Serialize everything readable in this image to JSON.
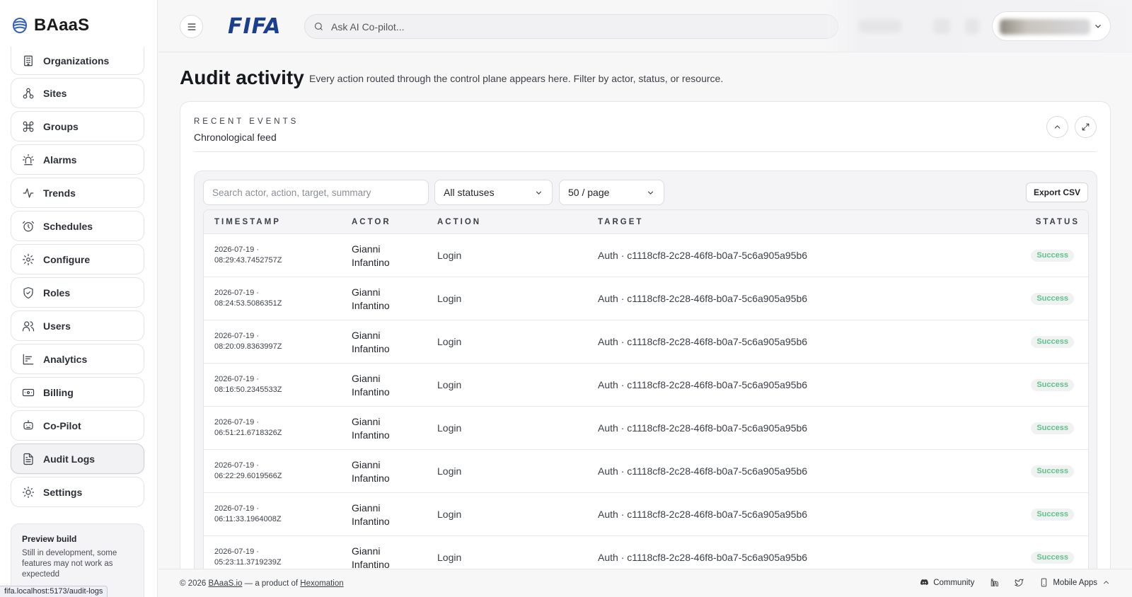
{
  "brand": {
    "name": "BAaaS"
  },
  "sidebar": {
    "items": [
      {
        "label": "Organizations",
        "icon": "building-icon"
      },
      {
        "label": "Sites",
        "icon": "sites-icon"
      },
      {
        "label": "Groups",
        "icon": "command-icon"
      },
      {
        "label": "Alarms",
        "icon": "siren-icon"
      },
      {
        "label": "Trends",
        "icon": "activity-icon"
      },
      {
        "label": "Schedules",
        "icon": "alarm-clock-icon"
      },
      {
        "label": "Configure",
        "icon": "gear-icon"
      },
      {
        "label": "Roles",
        "icon": "shield-icon"
      },
      {
        "label": "Users",
        "icon": "users-icon"
      },
      {
        "label": "Analytics",
        "icon": "chart-icon"
      },
      {
        "label": "Billing",
        "icon": "banknote-icon"
      },
      {
        "label": "Co-Pilot",
        "icon": "bot-icon"
      },
      {
        "label": "Audit Logs",
        "icon": "file-text-icon",
        "active": true
      },
      {
        "label": "Settings",
        "icon": "cog-icon"
      }
    ],
    "preview": {
      "title": "Preview build",
      "text": "Still in development, some features may not work as expectedd"
    },
    "status_url": "fifa.localhost:5173/audit-logs"
  },
  "header": {
    "org_logo": "FIFA",
    "search_placeholder": "Ask AI Co-pilot..."
  },
  "page": {
    "title": "Audit activity",
    "subtitle": "Every action routed through the control plane appears here. Filter by actor, status, or resource."
  },
  "card": {
    "eyebrow": "RECENT EVENTS",
    "heading": "Chronological feed"
  },
  "filters": {
    "search_placeholder": "Search actor, action, target, summary",
    "status_value": "All statuses",
    "page_size_value": "50 / page",
    "export_label": "Export CSV"
  },
  "table": {
    "columns": [
      "TIMESTAMP",
      "ACTOR",
      "ACTION",
      "TARGET",
      "STATUS"
    ],
    "rows": [
      {
        "date": "2026-07-19 ·",
        "time": "08:29:43.7452757Z",
        "actor_first": "Gianni",
        "actor_last": "Infantino",
        "action": "Login",
        "target": "Auth · c1118cf8-2c28-46f8-b0a7-5c6a905a95b6",
        "status": "Success"
      },
      {
        "date": "2026-07-19 ·",
        "time": "08:24:53.5086351Z",
        "actor_first": "Gianni",
        "actor_last": "Infantino",
        "action": "Login",
        "target": "Auth · c1118cf8-2c28-46f8-b0a7-5c6a905a95b6",
        "status": "Success"
      },
      {
        "date": "2026-07-19 ·",
        "time": "08:20:09.8363997Z",
        "actor_first": "Gianni",
        "actor_last": "Infantino",
        "action": "Login",
        "target": "Auth · c1118cf8-2c28-46f8-b0a7-5c6a905a95b6",
        "status": "Success"
      },
      {
        "date": "2026-07-19 ·",
        "time": "08:16:50.2345533Z",
        "actor_first": "Gianni",
        "actor_last": "Infantino",
        "action": "Login",
        "target": "Auth · c1118cf8-2c28-46f8-b0a7-5c6a905a95b6",
        "status": "Success"
      },
      {
        "date": "2026-07-19 ·",
        "time": "06:51:21.6718326Z",
        "actor_first": "Gianni",
        "actor_last": "Infantino",
        "action": "Login",
        "target": "Auth · c1118cf8-2c28-46f8-b0a7-5c6a905a95b6",
        "status": "Success"
      },
      {
        "date": "2026-07-19 ·",
        "time": "06:22:29.6019566Z",
        "actor_first": "Gianni",
        "actor_last": "Infantino",
        "action": "Login",
        "target": "Auth · c1118cf8-2c28-46f8-b0a7-5c6a905a95b6",
        "status": "Success"
      },
      {
        "date": "2026-07-19 ·",
        "time": "06:11:33.1964008Z",
        "actor_first": "Gianni",
        "actor_last": "Infantino",
        "action": "Login",
        "target": "Auth · c1118cf8-2c28-46f8-b0a7-5c6a905a95b6",
        "status": "Success"
      },
      {
        "date": "2026-07-19 ·",
        "time": "05:23:11.3719239Z",
        "actor_first": "Gianni",
        "actor_last": "Infantino",
        "action": "Login",
        "target": "Auth · c1118cf8-2c28-46f8-b0a7-5c6a905a95b6",
        "status": "Success"
      }
    ]
  },
  "footer": {
    "copyright_prefix": "© 2026",
    "company_link": "BAaaS.io",
    "product_of": "— a product of",
    "parent_link": "Hexomation",
    "community": "Community",
    "mobile_apps": "Mobile Apps"
  },
  "colors": {
    "accent_blue": "#1a3f8f",
    "success_text": "#5fc18a"
  }
}
